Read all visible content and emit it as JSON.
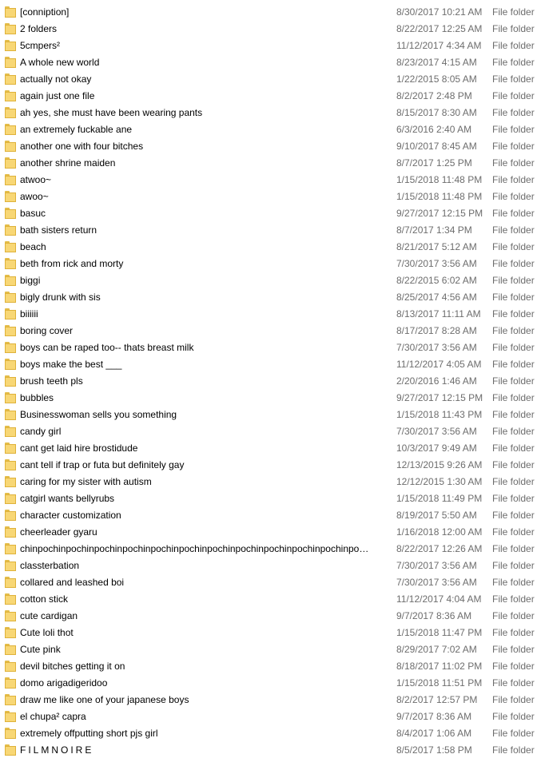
{
  "files": [
    {
      "name": "[conniption]",
      "date": "8/30/2017 10:21 AM",
      "type": "File folder",
      "icon": "folder-icon"
    },
    {
      "name": "2 folders",
      "date": "8/22/2017 12:25 AM",
      "type": "File folder",
      "icon": "folder-icon"
    },
    {
      "name": "5cmpers²",
      "date": "11/12/2017 4:34 AM",
      "type": "File folder",
      "icon": "folder-icon"
    },
    {
      "name": "A whole new world",
      "date": "8/23/2017 4:15 AM",
      "type": "File folder",
      "icon": "folder-icon"
    },
    {
      "name": "actually not okay",
      "date": "1/22/2015 8:05 AM",
      "type": "File folder",
      "icon": "folder-icon"
    },
    {
      "name": "again just one file",
      "date": "8/2/2017 2:48 PM",
      "type": "File folder",
      "icon": "folder-icon"
    },
    {
      "name": "ah yes, she must have been wearing pants",
      "date": "8/15/2017 8:30 AM",
      "type": "File folder",
      "icon": "folder-icon"
    },
    {
      "name": "an extremely fuckable ane",
      "date": "6/3/2016 2:40 AM",
      "type": "File folder",
      "icon": "folder-icon"
    },
    {
      "name": "another one with four bitches",
      "date": "9/10/2017 8:45 AM",
      "type": "File folder",
      "icon": "folder-icon"
    },
    {
      "name": "another shrine maiden",
      "date": "8/7/2017 1:25 PM",
      "type": "File folder",
      "icon": "folder-icon"
    },
    {
      "name": "atwoo~",
      "date": "1/15/2018 11:48 PM",
      "type": "File folder",
      "icon": "folder-icon"
    },
    {
      "name": "awoo~",
      "date": "1/15/2018 11:48 PM",
      "type": "File folder",
      "icon": "folder-icon"
    },
    {
      "name": "basuc",
      "date": "9/27/2017 12:15 PM",
      "type": "File folder",
      "icon": "folder-icon"
    },
    {
      "name": "bath sisters return",
      "date": "8/7/2017 1:34 PM",
      "type": "File folder",
      "icon": "folder-icon"
    },
    {
      "name": "beach",
      "date": "8/21/2017 5:12 AM",
      "type": "File folder",
      "icon": "folder-icon"
    },
    {
      "name": "beth from rick and morty",
      "date": "7/30/2017 3:56 AM",
      "type": "File folder",
      "icon": "folder-icon"
    },
    {
      "name": "biggi",
      "date": "8/22/2015 6:02 AM",
      "type": "File folder",
      "icon": "folder-icon"
    },
    {
      "name": "bigly drunk with sis",
      "date": "8/25/2017 4:56 AM",
      "type": "File folder",
      "icon": "folder-icon"
    },
    {
      "name": "biiiiii",
      "date": "8/13/2017 11:11 AM",
      "type": "File folder",
      "icon": "folder-icon"
    },
    {
      "name": "boring cover",
      "date": "8/17/2017 8:28 AM",
      "type": "File folder",
      "icon": "folder-icon"
    },
    {
      "name": "boys can be raped too-- thats breast milk",
      "date": "7/30/2017 3:56 AM",
      "type": "File folder",
      "icon": "folder-icon"
    },
    {
      "name": "boys make the best ___",
      "date": "11/12/2017 4:05 AM",
      "type": "File folder",
      "icon": "folder-icon"
    },
    {
      "name": "brush teeth pls",
      "date": "2/20/2016 1:46 AM",
      "type": "File folder",
      "icon": "folder-icon"
    },
    {
      "name": "bubbles",
      "date": "9/27/2017 12:15 PM",
      "type": "File folder",
      "icon": "folder-icon"
    },
    {
      "name": "Businesswoman sells you something",
      "date": "1/15/2018 11:43 PM",
      "type": "File folder",
      "icon": "folder-icon"
    },
    {
      "name": "candy girl",
      "date": "7/30/2017 3:56 AM",
      "type": "File folder",
      "icon": "folder-icon"
    },
    {
      "name": "cant get laid hire brostidude",
      "date": "10/3/2017 9:49 AM",
      "type": "File folder",
      "icon": "folder-icon"
    },
    {
      "name": "cant tell if trap or futa but definitely gay",
      "date": "12/13/2015 9:26 AM",
      "type": "File folder",
      "icon": "folder-icon"
    },
    {
      "name": "caring for my sister with autism",
      "date": "12/12/2015 1:30 AM",
      "type": "File folder",
      "icon": "folder-icon"
    },
    {
      "name": "catgirl wants bellyrubs",
      "date": "1/15/2018 11:49 PM",
      "type": "File folder",
      "icon": "folder-icon"
    },
    {
      "name": "character customization",
      "date": "8/19/2017 5:50 AM",
      "type": "File folder",
      "icon": "folder-icon"
    },
    {
      "name": "cheerleader gyaru",
      "date": "1/16/2018 12:00 AM",
      "type": "File folder",
      "icon": "folder-icon"
    },
    {
      "name": "chinpochinpochinpochinpochinpochinpochinpochinpochinpochinpochinpochinpo…",
      "date": "8/22/2017 12:26 AM",
      "type": "File folder",
      "icon": "folder-icon"
    },
    {
      "name": "classterbation",
      "date": "7/30/2017 3:56 AM",
      "type": "File folder",
      "icon": "folder-icon"
    },
    {
      "name": "collared and leashed boi",
      "date": "7/30/2017 3:56 AM",
      "type": "File folder",
      "icon": "folder-icon"
    },
    {
      "name": "cotton stick",
      "date": "11/12/2017 4:04 AM",
      "type": "File folder",
      "icon": "folder-icon"
    },
    {
      "name": "cute cardigan",
      "date": "9/7/2017 8:36 AM",
      "type": "File folder",
      "icon": "folder-icon"
    },
    {
      "name": "Cute loli thot",
      "date": "1/15/2018 11:47 PM",
      "type": "File folder",
      "icon": "folder-icon"
    },
    {
      "name": "Cute pink",
      "date": "8/29/2017 7:02 AM",
      "type": "File folder",
      "icon": "folder-icon"
    },
    {
      "name": "devil bitches getting it on",
      "date": "8/18/2017 11:02 PM",
      "type": "File folder",
      "icon": "folder-icon"
    },
    {
      "name": "domo arigadigeridoo",
      "date": "1/15/2018 11:51 PM",
      "type": "File folder",
      "icon": "folder-icon"
    },
    {
      "name": "draw me like one of your japanese boys",
      "date": "8/2/2017 12:57 PM",
      "type": "File folder",
      "icon": "folder-icon"
    },
    {
      "name": "el chupa² capra",
      "date": "9/7/2017 8:36 AM",
      "type": "File folder",
      "icon": "folder-icon"
    },
    {
      "name": "extremely offputting short pjs girl",
      "date": "8/4/2017 1:06 AM",
      "type": "File folder",
      "icon": "folder-icon"
    },
    {
      "name": "FILMNOIRE",
      "date": "8/5/2017 1:58 PM",
      "type": "File folder",
      "icon": "folder-icon",
      "spaced": true
    }
  ],
  "colors": {
    "folder_fill": "#f8d775",
    "folder_edge": "#dfb23a",
    "meta_text": "#6d6d6d",
    "name_text": "#000000"
  }
}
